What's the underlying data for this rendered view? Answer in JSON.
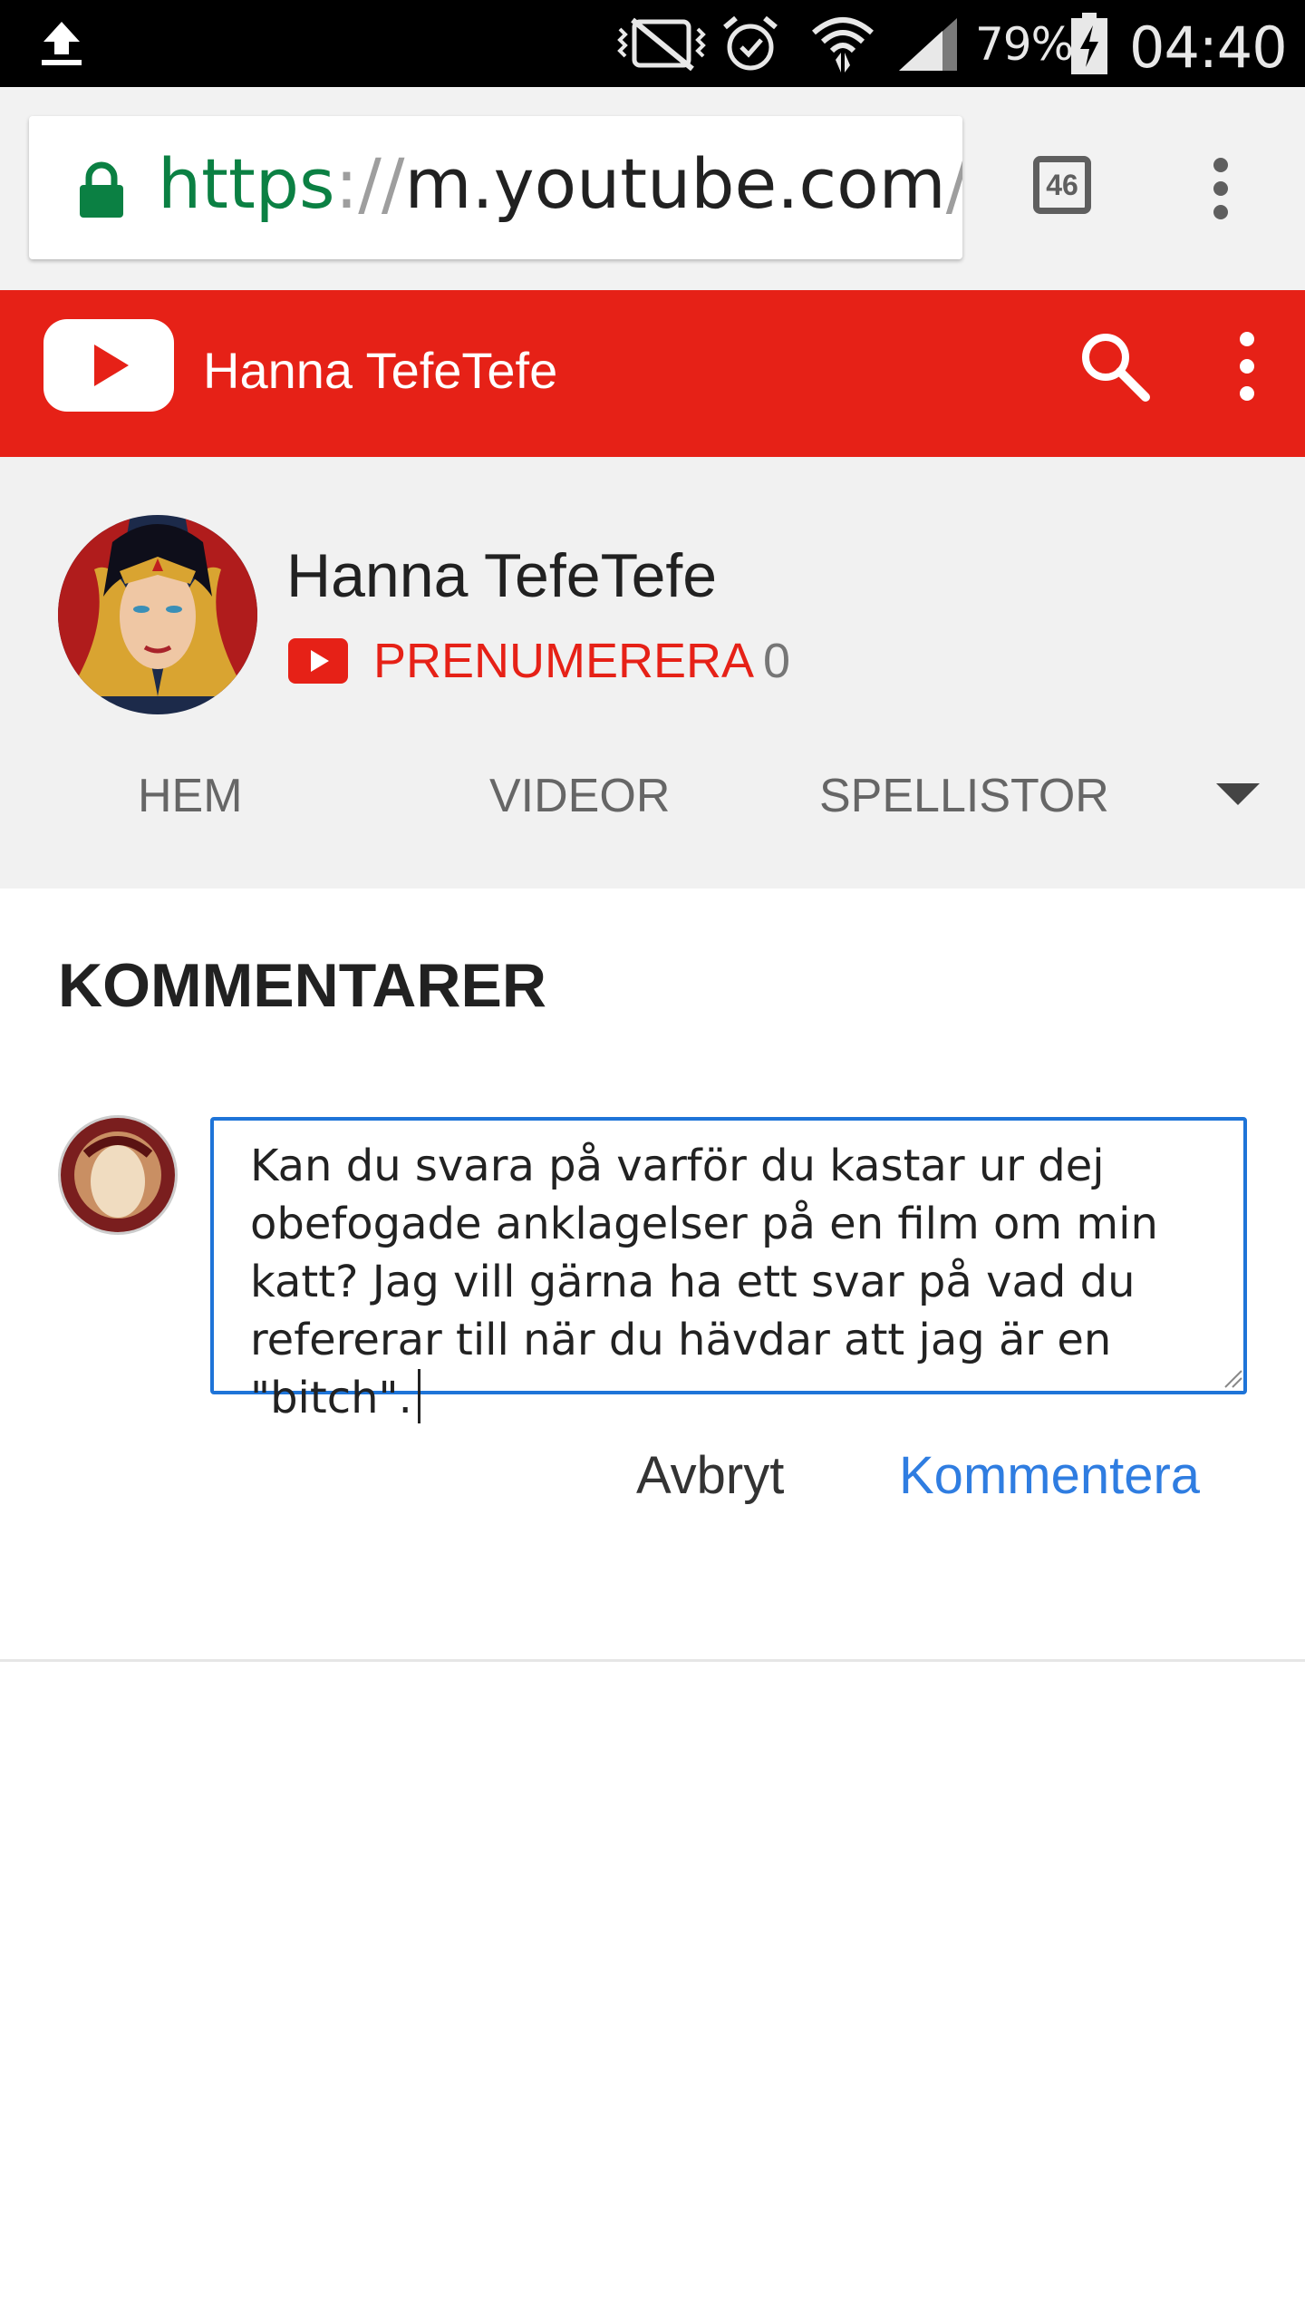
{
  "status_bar": {
    "icons": [
      "upload-icon",
      "mute-vibrate-icon",
      "alarm-icon",
      "wifi-icon",
      "cell-signal-icon",
      "battery-charging-icon"
    ],
    "battery_percent": "79%",
    "time": "04:40"
  },
  "browser": {
    "url_scheme": "https",
    "url_separator": "://",
    "url_host": "m.youtube.com",
    "url_path": "/c",
    "tab_count": "46",
    "colors": {
      "secure": "#0b8043"
    }
  },
  "youtube_header": {
    "title": "Hanna TefeTefe",
    "colors": {
      "brand": "#e62117"
    }
  },
  "channel": {
    "name": "Hanna TefeTefe",
    "subscribe_label": "PRENUMERERA",
    "subscriber_count": "0",
    "tabs": [
      {
        "label": "HEM"
      },
      {
        "label": "VIDEOR"
      },
      {
        "label": "SPELLISTOR"
      }
    ]
  },
  "comments": {
    "heading": "KOMMENTARER",
    "input_value": "Kan du svara på varför du kastar ur dej obefogade anklagelser på en film om min katt? Jag vill gärna ha ett svar på vad du refererar till när du hävdar att jag är en \"bitch\".",
    "cancel_label": "Avbryt",
    "submit_label": "Kommentera",
    "colors": {
      "input_border": "#1e74d8",
      "submit": "#2f7de1"
    }
  }
}
